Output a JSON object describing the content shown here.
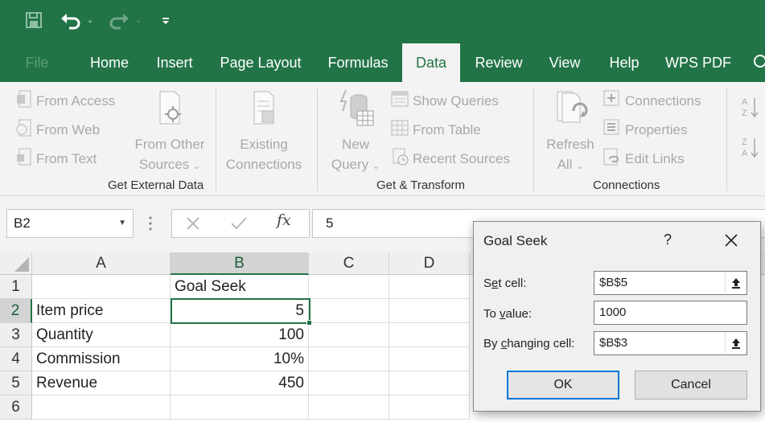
{
  "colors": {
    "excel_green": "#227447",
    "ribbon_bg": "#f3f3f3",
    "disabled_text": "#a8a8a8",
    "selection_border": "#217346",
    "primary_button_border": "#0078d7"
  },
  "quick_access": {
    "save_icon": "save-icon",
    "undo_icon": "undo-icon",
    "redo_icon": "redo-icon",
    "customize_icon": "customize-icon"
  },
  "tabs": [
    {
      "label": "File"
    },
    {
      "label": "Home"
    },
    {
      "label": "Insert"
    },
    {
      "label": "Page Layout"
    },
    {
      "label": "Formulas"
    },
    {
      "label": "Data"
    },
    {
      "label": "Review"
    },
    {
      "label": "View"
    },
    {
      "label": "Help"
    },
    {
      "label": "WPS PDF"
    }
  ],
  "ribbon": {
    "get_external_data": {
      "from_access": "From Access",
      "from_web": "From Web",
      "from_text": "From Text",
      "from_other_sources_1": "From Other",
      "from_other_sources_2": "Sources",
      "existing_connections_1": "Existing",
      "existing_connections_2": "Connections",
      "label": "Get External Data"
    },
    "get_transform": {
      "new_query_1": "New",
      "new_query_2": "Query",
      "show_queries": "Show Queries",
      "from_table": "From Table",
      "recent_sources": "Recent Sources",
      "label": "Get & Transform"
    },
    "connections": {
      "refresh_all_1": "Refresh",
      "refresh_all_2": "All",
      "connections": "Connections",
      "properties": "Properties",
      "edit_links": "Edit Links",
      "label": "Connections"
    },
    "sort": {
      "asc_icon": "sort-az-icon",
      "desc_icon": "sort-za-icon"
    }
  },
  "formula_bar": {
    "name_box": "B2",
    "fx": "fx",
    "value": "5"
  },
  "grid": {
    "columns": [
      "A",
      "B",
      "C",
      "D"
    ],
    "selected_column": "B",
    "selected_row": "2",
    "rows": [
      {
        "num": "1",
        "a": "",
        "b": "Goal Seek"
      },
      {
        "num": "2",
        "a": "Item price",
        "b": "5"
      },
      {
        "num": "3",
        "a": "Quantity",
        "b": "100"
      },
      {
        "num": "4",
        "a": "Commission",
        "b": "10%"
      },
      {
        "num": "5",
        "a": "Revenue",
        "b": "450"
      },
      {
        "num": "6",
        "a": "",
        "b": ""
      }
    ]
  },
  "dialog": {
    "title": "Goal Seek",
    "help": "?",
    "set_cell_label_pre": "S",
    "set_cell_label_u": "e",
    "set_cell_label_post": "t cell:",
    "set_cell_value": "$B$5",
    "to_value_label_pre": "To ",
    "to_value_label_u": "v",
    "to_value_label_post": "alue:",
    "to_value_value": "1000",
    "by_changing_label_pre": "By ",
    "by_changing_label_u": "c",
    "by_changing_label_post": "hanging cell:",
    "by_changing_value": "$B$3",
    "ok": "OK",
    "cancel": "Cancel"
  }
}
